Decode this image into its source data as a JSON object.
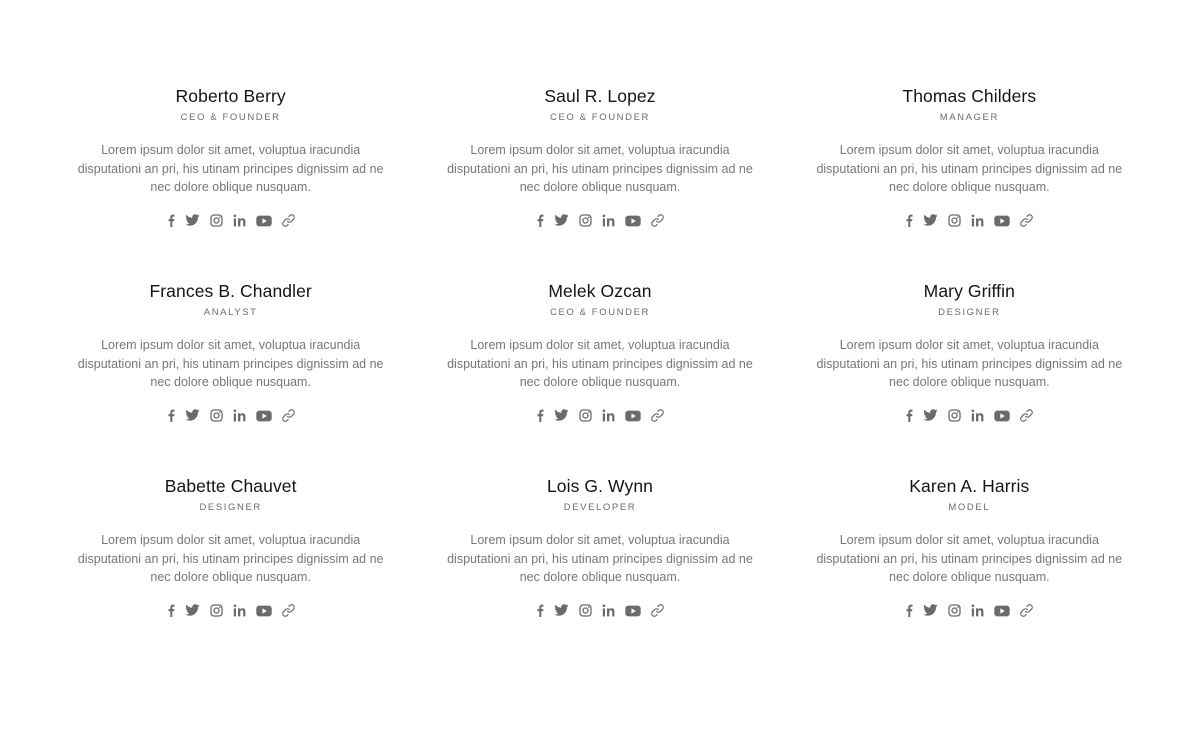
{
  "team": {
    "members": [
      {
        "name": "Roberto Berry",
        "role": "CEO & FOUNDER",
        "bio": "Lorem ipsum dolor sit amet, voluptua iracundia disputationi an pri, his utinam principes dignissim ad ne nec dolore oblique nusquam."
      },
      {
        "name": "Saul R. Lopez",
        "role": "CEO & FOUNDER",
        "bio": "Lorem ipsum dolor sit amet, voluptua iracundia disputationi an pri, his utinam principes dignissim ad ne nec dolore oblique nusquam."
      },
      {
        "name": "Thomas Childers",
        "role": "MANAGER",
        "bio": "Lorem ipsum dolor sit amet, voluptua iracundia disputationi an pri, his utinam principes dignissim ad ne nec dolore oblique nusquam."
      },
      {
        "name": "Frances B. Chandler",
        "role": "ANALYST",
        "bio": "Lorem ipsum dolor sit amet, voluptua iracundia disputationi an pri, his utinam principes dignissim ad ne nec dolore oblique nusquam."
      },
      {
        "name": "Melek Ozcan",
        "role": "CEO & FOUNDER",
        "bio": "Lorem ipsum dolor sit amet, voluptua iracundia disputationi an pri, his utinam principes dignissim ad ne nec dolore oblique nusquam."
      },
      {
        "name": "Mary Griffin",
        "role": "DESIGNER",
        "bio": "Lorem ipsum dolor sit amet, voluptua iracundia disputationi an pri, his utinam principes dignissim ad ne nec dolore oblique nusquam."
      },
      {
        "name": "Babette Chauvet",
        "role": "DESIGNER",
        "bio": "Lorem ipsum dolor sit amet, voluptua iracundia disputationi an pri, his utinam principes dignissim ad ne nec dolore oblique nusquam."
      },
      {
        "name": "Lois G. Wynn",
        "role": "DEVELOPER",
        "bio": "Lorem ipsum dolor sit amet, voluptua iracundia disputationi an pri, his utinam principes dignissim ad ne nec dolore oblique nusquam."
      },
      {
        "name": "Karen A. Harris",
        "role": "MODEL",
        "bio": "Lorem ipsum dolor sit amet, voluptua iracundia disputationi an pri, his utinam principes dignissim ad ne nec dolore oblique nusquam."
      }
    ],
    "social_icons": [
      "facebook-icon",
      "twitter-icon",
      "instagram-icon",
      "linkedin-icon",
      "youtube-icon",
      "link-icon"
    ],
    "icon_color": "#6b6b6b"
  }
}
